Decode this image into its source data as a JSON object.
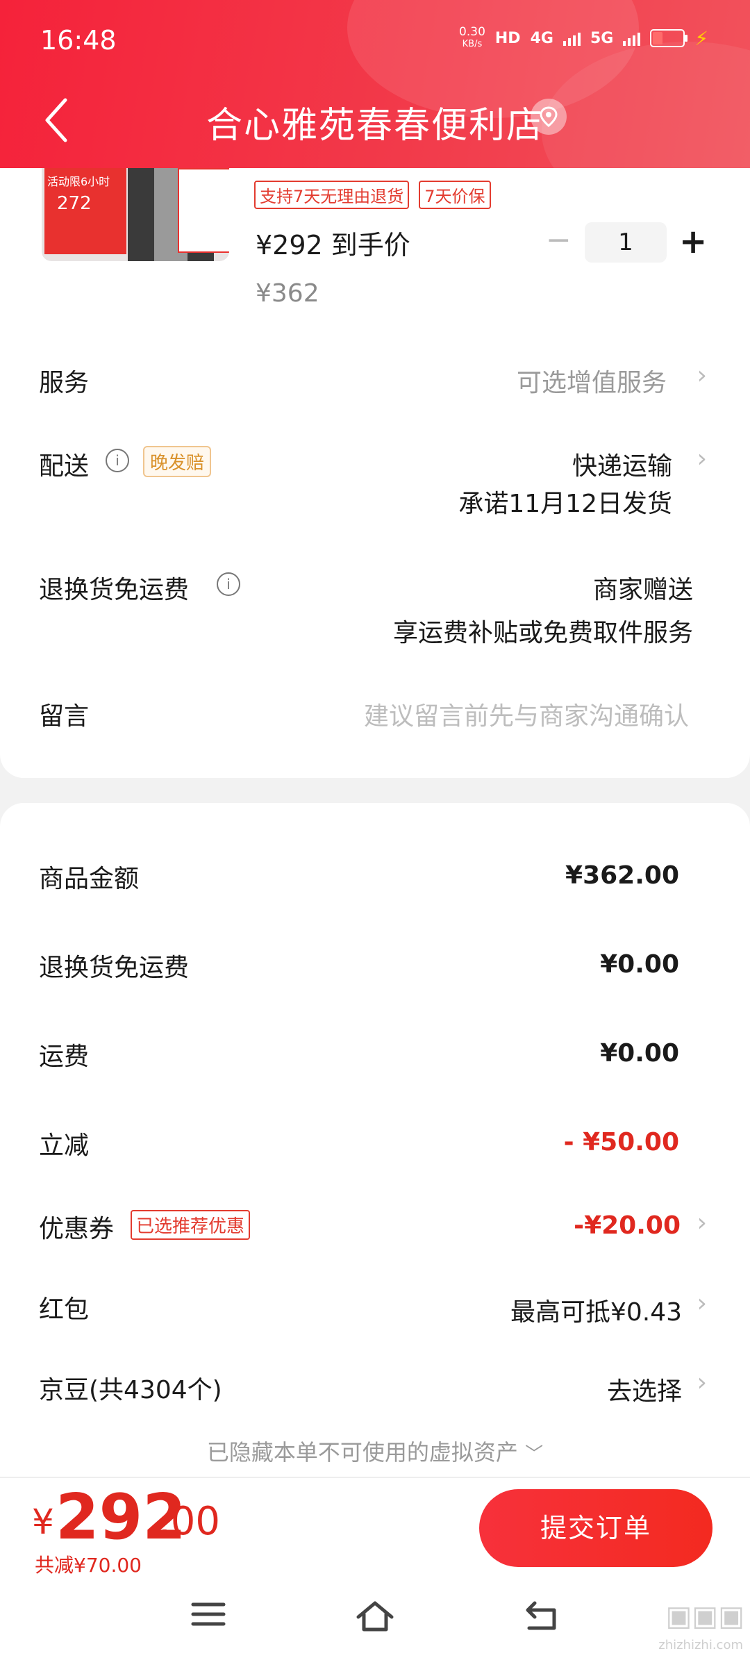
{
  "status_bar": {
    "time": "16:48",
    "net_speed_value": "0.30",
    "net_speed_unit": "KB/s",
    "hd": "HD",
    "net1": "4G",
    "net2": "5G"
  },
  "header": {
    "title": "合心雅苑春春便利店"
  },
  "product": {
    "thumb_text": "活动限6小时",
    "thumb_price": "272",
    "tags": [
      "支持7天无理由退货",
      "7天价保"
    ],
    "final_price": "¥292 到手价",
    "original_price": "¥362",
    "quantity": "1",
    "minus": "−",
    "plus": "+"
  },
  "rows": {
    "service_label": "服务",
    "service_value": "可选增值服务",
    "delivery_label": "配送",
    "delivery_badge": "晚发赔",
    "delivery_value": "快递运输",
    "delivery_promise": "承诺11月12日发货",
    "return_label": "退换货免运费",
    "return_value": "商家赠送",
    "return_desc": "享运费补贴或免费取件服务",
    "message_label": "留言",
    "message_placeholder": "建议留言前先与商家沟通确认"
  },
  "summary": {
    "goods_label": "商品金额",
    "goods_value": "¥362.00",
    "return_fee_label": "退换货免运费",
    "return_fee_value": "¥0.00",
    "shipping_label": "运费",
    "shipping_value": "¥0.00",
    "discount_label": "立减",
    "discount_value": "- ¥50.00",
    "coupon_label": "优惠券",
    "coupon_badge": "已选推荐优惠",
    "coupon_value": "-¥20.00",
    "redpacket_label": "红包",
    "redpacket_value": "最高可抵¥0.43",
    "jingdou_label": "京豆(共4304个)",
    "jingdou_value": "去选择",
    "hidden_note": "已隐藏本单不可使用的虚拟资产"
  },
  "footer": {
    "currency": "¥",
    "total_int": "292",
    "total_dec": ".00",
    "saved": "共减¥70.00",
    "submit": "提交订单"
  },
  "watermark": {
    "text": "zhizhizhi.com"
  },
  "colors": {
    "brand_red": "#f5223a",
    "price_red": "#e0281f",
    "submit_red": "#f32a20"
  }
}
